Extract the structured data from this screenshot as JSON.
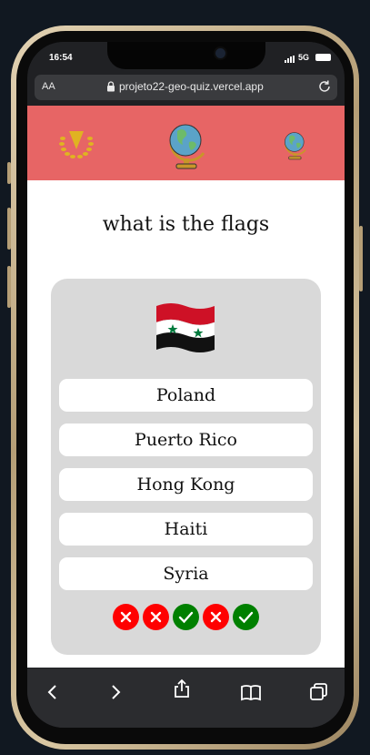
{
  "status": {
    "time": "16:54",
    "network": "5G"
  },
  "browser": {
    "text_size_label": "AA",
    "url": "projeto22-geo-quiz.vercel.app"
  },
  "header": {
    "left_icon": "laurel-wreath-icon",
    "center_icon": "globe-icon",
    "right_icon": "globe-icon"
  },
  "quiz": {
    "title": "what is the flags",
    "flag": {
      "country_icon": "syria-flag",
      "colors": [
        "#ce1126",
        "#ffffff",
        "#000000",
        "#007a3d"
      ]
    },
    "answers": [
      "Poland",
      "Puerto Rico",
      "Hong Kong",
      "Haiti",
      "Syria"
    ],
    "results": [
      "wrong",
      "wrong",
      "correct",
      "wrong",
      "correct"
    ],
    "colors": {
      "wrong": "#ff0000",
      "correct": "#008000"
    }
  },
  "colors": {
    "header_bg": "#e76565",
    "card_bg": "#d9d9d9"
  },
  "toolbar": [
    "back-icon",
    "forward-icon",
    "share-icon",
    "bookmarks-icon",
    "tabs-icon"
  ]
}
